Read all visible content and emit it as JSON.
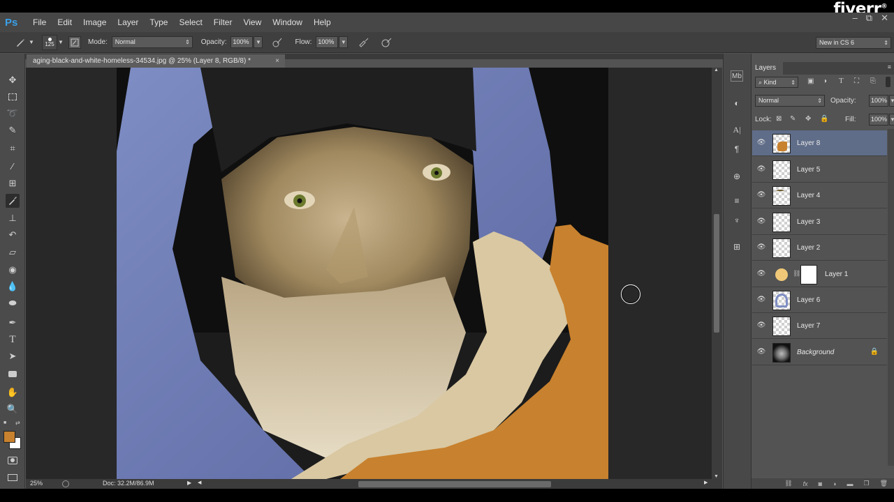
{
  "app": {
    "logo": "Ps",
    "brand": "fiverr",
    "brand_mark": "®"
  },
  "menu": [
    "File",
    "Edit",
    "Image",
    "Layer",
    "Type",
    "Select",
    "Filter",
    "View",
    "Window",
    "Help"
  ],
  "window_controls": {
    "minimize": "–",
    "restore": "⧉",
    "close": "✕"
  },
  "options_bar": {
    "brush_size": "125",
    "mode_label": "Mode:",
    "mode_value": "Normal",
    "opacity_label": "Opacity:",
    "opacity_value": "100%",
    "flow_label": "Flow:",
    "flow_value": "100%"
  },
  "workspace": {
    "value": "New in CS 6"
  },
  "document": {
    "tab_title": "aging-black-and-white-homeless-34534.jpg @ 25% (Layer 8, RGB/8) *",
    "close": "×"
  },
  "status": {
    "zoom": "25%",
    "doc": "Doc: 32.2M/86.9M"
  },
  "layers_panel": {
    "tab": "Layers",
    "filter_kind": "Kind",
    "blend_mode": "Normal",
    "opacity_label": "Opacity:",
    "opacity_value": "100%",
    "lock_label": "Lock:",
    "fill_label": "Fill:",
    "fill_value": "100%",
    "layers": [
      {
        "name": "Layer 8",
        "selected": true
      },
      {
        "name": "Layer 5",
        "selected": false
      },
      {
        "name": "Layer 4",
        "selected": false
      },
      {
        "name": "Layer 3",
        "selected": false
      },
      {
        "name": "Layer 2",
        "selected": false
      },
      {
        "name": "Layer 1",
        "selected": false
      },
      {
        "name": "Layer 6",
        "selected": false
      },
      {
        "name": "Layer 7",
        "selected": false
      },
      {
        "name": "Background",
        "selected": false
      }
    ],
    "bottom_icons": [
      "link-icon",
      "fx-icon",
      "mask-icon",
      "adjustment-icon",
      "group-icon",
      "new-layer-icon",
      "trash-icon"
    ]
  },
  "colors": {
    "foreground": "#c8812e",
    "background": "#ffffff",
    "selection": "#5f6d89",
    "canvas_bg": "#282828"
  }
}
